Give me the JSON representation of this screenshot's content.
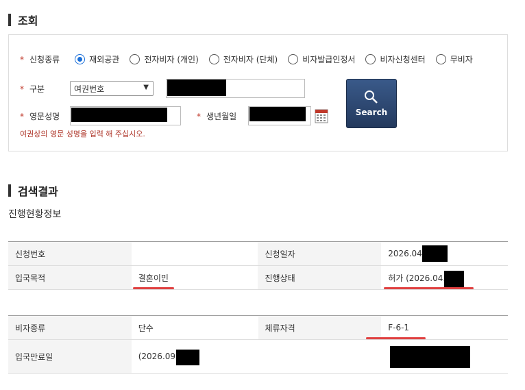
{
  "section1": {
    "title": "조회"
  },
  "form": {
    "type_label": "신청종류",
    "radios": [
      {
        "label": "재외공관",
        "checked": true
      },
      {
        "label": "전자비자 (개인)",
        "checked": false
      },
      {
        "label": "전자비자 (단체)",
        "checked": false
      },
      {
        "label": "비자발급인정서",
        "checked": false
      },
      {
        "label": "비자신청센터",
        "checked": false
      },
      {
        "label": "무비자",
        "checked": false
      }
    ],
    "category_label": "구분",
    "category_value": "여권번호",
    "eng_name_label": "영문성명",
    "birth_label": "생년월일",
    "hint": "여권상의 영문 성명을 입력 해 주십시오.",
    "search_label": "Search"
  },
  "section2": {
    "title": "검색결과",
    "subtitle": "진행현황정보"
  },
  "table1": {
    "r1": {
      "h1": "신청번호",
      "v1": "",
      "h2": "신청일자",
      "v2": "2026.04"
    },
    "r2": {
      "h1": "입국목적",
      "v1": "결혼이민",
      "h2": "진행상태",
      "v2": "허가 (2026.04."
    }
  },
  "table2": {
    "r1": {
      "h1": "비자종류",
      "v1": "단수",
      "h2": "체류자격",
      "v2": "F-6-1"
    },
    "r2": {
      "h1": "입국만료일",
      "v1": "(2026.09.",
      "h2": "",
      "v2": ""
    }
  },
  "colors": {
    "accent": "#1a6fd8",
    "required": "#c0392b",
    "underline": "#e04040",
    "button": "#2c4770"
  }
}
